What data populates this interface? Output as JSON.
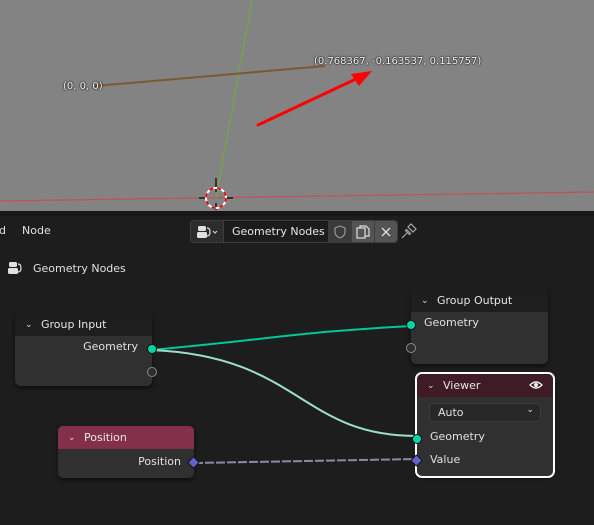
{
  "viewport": {
    "origin_label": "(0, 0, 0)",
    "point_label": "(0.768367, -0.163537, 0.115757)",
    "colors": {
      "background": "#838383",
      "x_axis": "#c0505a",
      "y_axis": "#7aa04a",
      "edge": "#7a5a30",
      "annotation_arrow": "#ff0000"
    }
  },
  "header": {
    "menu_partial": "d",
    "menu_node": "Node",
    "datablock_type_icon": "node-tree-icon",
    "datablock_name": "Geometry Nodes",
    "fake_user_icon": "shield-icon",
    "duplicate_icon": "duplicate-icon",
    "unlink_icon": "close-icon",
    "pin_icon": "pin-icon"
  },
  "breadcrumb": {
    "icon": "node-tree-icon",
    "label": "Geometry Nodes"
  },
  "nodes": {
    "group_input": {
      "title": "Group Input",
      "outputs": [
        "Geometry",
        ""
      ]
    },
    "group_output": {
      "title": "Group Output",
      "inputs": [
        "Geometry",
        ""
      ]
    },
    "viewer": {
      "title": "Viewer",
      "domain": "Auto",
      "inputs": [
        "Geometry",
        "Value"
      ],
      "eye_icon": "eye-icon"
    },
    "position": {
      "title": "Position",
      "outputs": [
        "Position"
      ]
    }
  },
  "colors": {
    "geometry_socket": "#00d6a3",
    "vector_socket": "#6363c7",
    "input_header": "#1d1d1d",
    "viewer_header": "#3f1c25",
    "position_header": "#83314a",
    "geometry_link": "#00c896",
    "viewer_link": "#9be0c8",
    "vector_link": "#8a8aa8"
  }
}
